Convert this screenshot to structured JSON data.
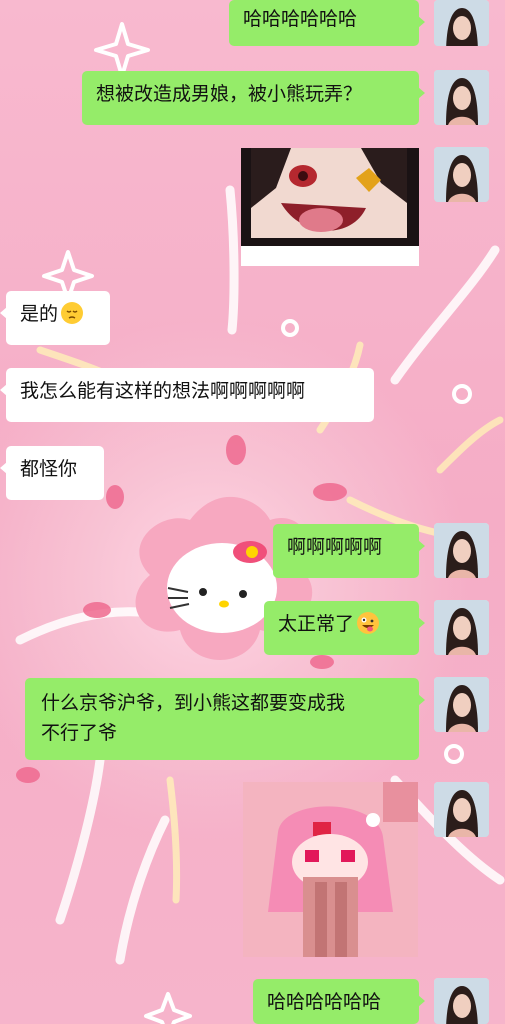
{
  "messages": [
    {
      "side": "right",
      "type": "text",
      "text": "哈哈哈哈哈哈"
    },
    {
      "side": "right",
      "type": "text",
      "text": "想被改造成男娘，被小熊玩弄？"
    },
    {
      "side": "right",
      "type": "image",
      "description": "anime-sticker"
    },
    {
      "side": "left",
      "type": "text",
      "text": "是的",
      "emoji": "pensive-face"
    },
    {
      "side": "left",
      "type": "text",
      "text": "我怎么能有这样的想法啊啊啊啊啊"
    },
    {
      "side": "left",
      "type": "text",
      "text": "都怪你"
    },
    {
      "side": "right",
      "type": "text",
      "text": "啊啊啊啊啊"
    },
    {
      "side": "right",
      "type": "text",
      "text": "太正常了",
      "emoji": "zany-face"
    },
    {
      "side": "right",
      "type": "text",
      "lines": [
        "什么京爷沪爷，到小熊这都要变成我",
        "不行了爷"
      ]
    },
    {
      "side": "right",
      "type": "image",
      "description": "pixel-sticker"
    },
    {
      "side": "right",
      "type": "text",
      "text": "哈哈哈哈哈哈"
    }
  ],
  "colors": {
    "outgoing_bubble": "#95ec69",
    "incoming_bubble": "#ffffff",
    "background": "#f6b3c9"
  }
}
